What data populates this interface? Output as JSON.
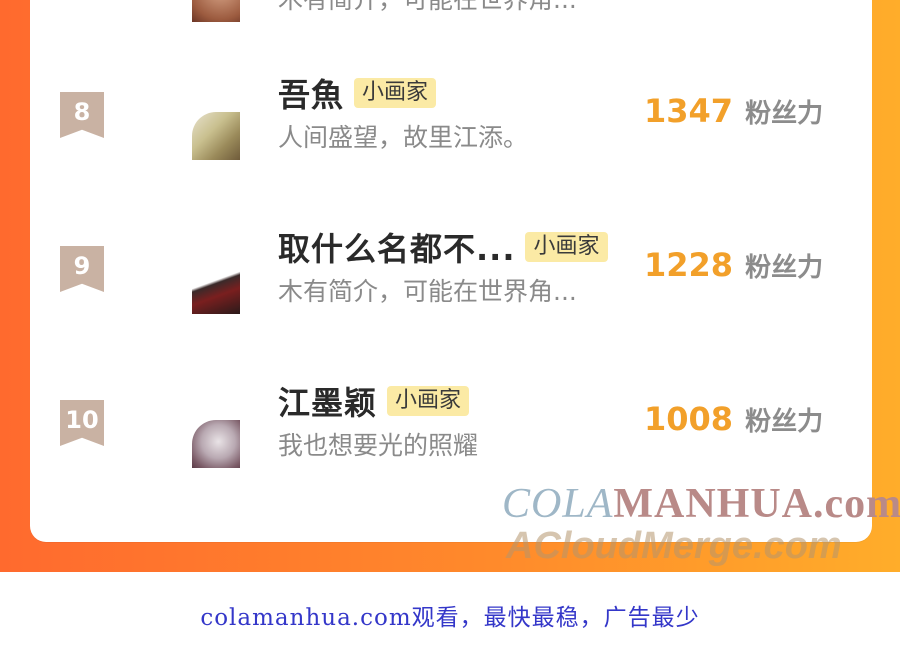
{
  "rows": [
    {
      "rank": "",
      "name": "",
      "tag": "",
      "desc": "木有简介，可能在世界角...",
      "score": "",
      "unit": ""
    },
    {
      "rank": "8",
      "name": "吾魚",
      "tag": "小画家",
      "desc": "人间盛望，故里江添。",
      "score": "1347",
      "unit": "粉丝力"
    },
    {
      "rank": "9",
      "name": "取什么名都不...",
      "tag": "小画家",
      "desc": "木有简介，可能在世界角...",
      "score": "1228",
      "unit": "粉丝力"
    },
    {
      "rank": "10",
      "name": "江墨颖",
      "tag": "小画家",
      "desc": "我也想要光的照耀",
      "score": "1008",
      "unit": "粉丝力"
    }
  ],
  "watermark": {
    "line1_a": "COLA",
    "line1_b": "MANHUA.com",
    "line2": "ACloudMerge.com"
  },
  "footer": {
    "text": "colamanhua.com观看，最快最稳，广告最少"
  },
  "colors": {
    "frame_gradient_start": "#ff6a2e",
    "frame_gradient_end": "#ffad2a",
    "score": "#f2a02a",
    "tag_bg": "#fbeaa5",
    "badge": "#c9b2a3",
    "footer_text": "#3437c9"
  }
}
